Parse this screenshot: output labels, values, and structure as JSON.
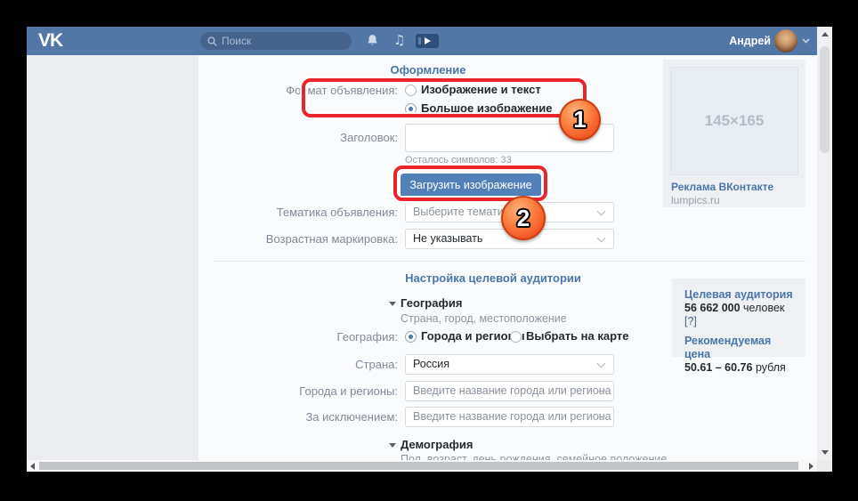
{
  "colors": {
    "header_bg": "#5077a6",
    "accent_blue": "#4a76a8",
    "button_blue": "#5181b8",
    "annotation_red": "#e9242a",
    "badge_orange": "#ef4f1d"
  },
  "header": {
    "logo": "VK",
    "search_placeholder": "Поиск",
    "user_name": "Андрей"
  },
  "annotations": {
    "badge1": "1",
    "badge2": "2"
  },
  "design_section": {
    "title": "Оформление",
    "format_label": "Формат объявления:",
    "format_options": [
      {
        "label": "Изображение и текст",
        "selected": false
      },
      {
        "label": "Большое изображение",
        "selected": true
      }
    ],
    "title_label": "Заголовок:",
    "title_value": "",
    "chars_left": "Осталось символов: 33",
    "upload_button": "Загрузить изображение",
    "topic_label": "Тематика объявления:",
    "topic_value": "Выберите тематику",
    "age_label": "Возрастная маркировка:",
    "age_value": "Не указывать"
  },
  "audience_section": {
    "title": "Настройка целевой аудитории",
    "geography_header": "География",
    "geography_sub": "Страна, город, местоположение",
    "geography_label": "География:",
    "geo_options": [
      {
        "label": "Города и регионы",
        "selected": true
      },
      {
        "label": "Выбрать на карте",
        "selected": false
      }
    ],
    "country_label": "Страна:",
    "country_value": "Россия",
    "cities_label": "Города и регионы:",
    "cities_placeholder": "Введите название города или региона",
    "except_label": "За исключением:",
    "except_placeholder": "Введите название города или региона",
    "demography_header": "Демография",
    "demography_sub": "Пол, возраст, день рождения, семейное положение"
  },
  "preview_card": {
    "placeholder": "145×165",
    "ad_title": "Реклама ВКонтакте",
    "ad_domain": "lumpics.ru"
  },
  "stats_card": {
    "audience_title": "Целевая аудитория",
    "audience_value": "56 662 000",
    "audience_unit": " человек ",
    "audience_help": "[?]",
    "price_title": "Рекомендуемая цена",
    "price_value": "50.61 – 60.76",
    "price_unit": " рубля"
  }
}
